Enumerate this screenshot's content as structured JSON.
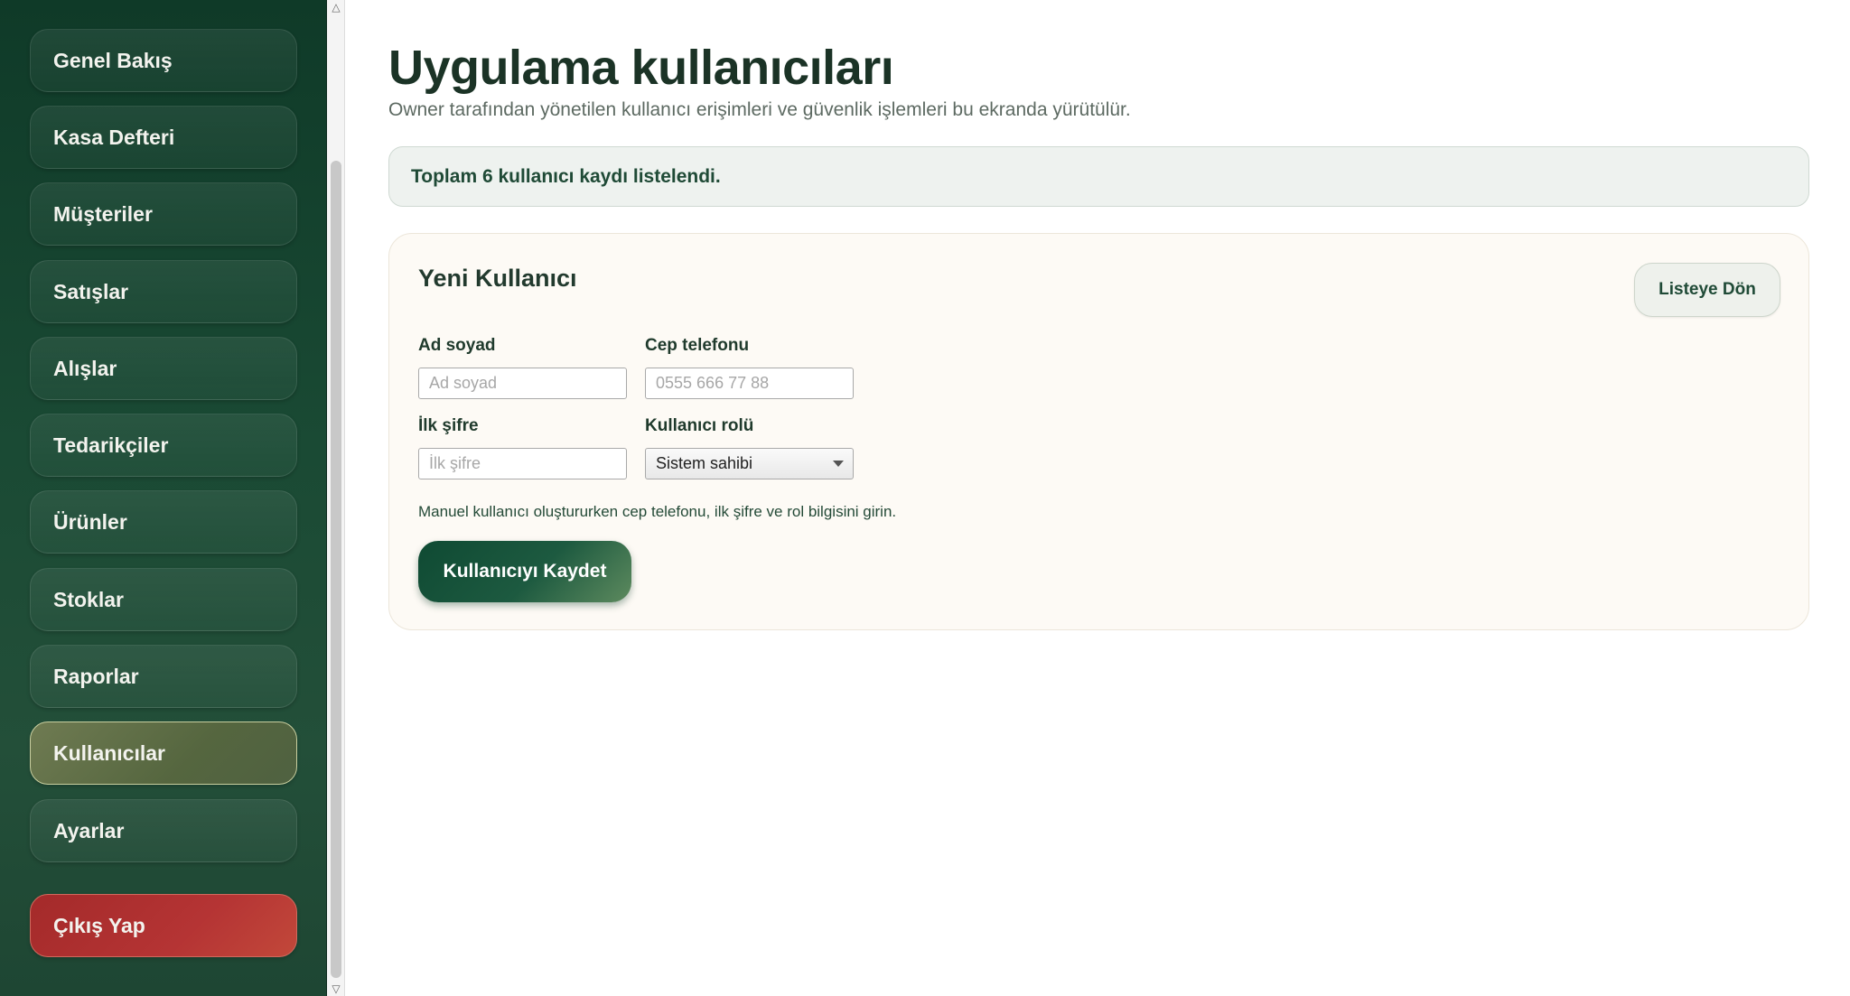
{
  "sidebar": {
    "items": [
      {
        "label": "Genel Bakış"
      },
      {
        "label": "Kasa Defteri"
      },
      {
        "label": "Müşteriler"
      },
      {
        "label": "Satışlar"
      },
      {
        "label": "Alışlar"
      },
      {
        "label": "Tedarikçiler"
      },
      {
        "label": "Ürünler"
      },
      {
        "label": "Stoklar"
      },
      {
        "label": "Raporlar"
      },
      {
        "label": "Kullanıcılar",
        "active": true
      },
      {
        "label": "Ayarlar"
      }
    ],
    "logout_label": "Çıkış Yap"
  },
  "header": {
    "title": "Uygulama kullanıcıları",
    "subtitle": "Owner tarafından yönetilen kullanıcı erişimleri ve güvenlik işlemleri bu ekranda yürütülür."
  },
  "banner": {
    "text": "Toplam 6 kullanıcı kaydı listelendi."
  },
  "form": {
    "title": "Yeni Kullanıcı",
    "back_label": "Listeye Dön",
    "full_name": {
      "label": "Ad soyad",
      "placeholder": "Ad soyad",
      "value": ""
    },
    "phone": {
      "label": "Cep telefonu",
      "placeholder": "0555 666 77 88",
      "value": ""
    },
    "password": {
      "label": "İlk şifre",
      "placeholder": "İlk şifre",
      "value": ""
    },
    "role": {
      "label": "Kullanıcı rolü",
      "selected": "Sistem sahibi"
    },
    "hint": "Manuel kullanıcı oluştururken cep telefonu, ilk şifre ve rol bilgisini girin.",
    "save_label": "Kullanıcıyı Kaydet"
  },
  "colors": {
    "sidebar_bg": "#163f2c",
    "active_item": "#62704a",
    "logout": "#b03030",
    "primary": "#1d5a40"
  }
}
